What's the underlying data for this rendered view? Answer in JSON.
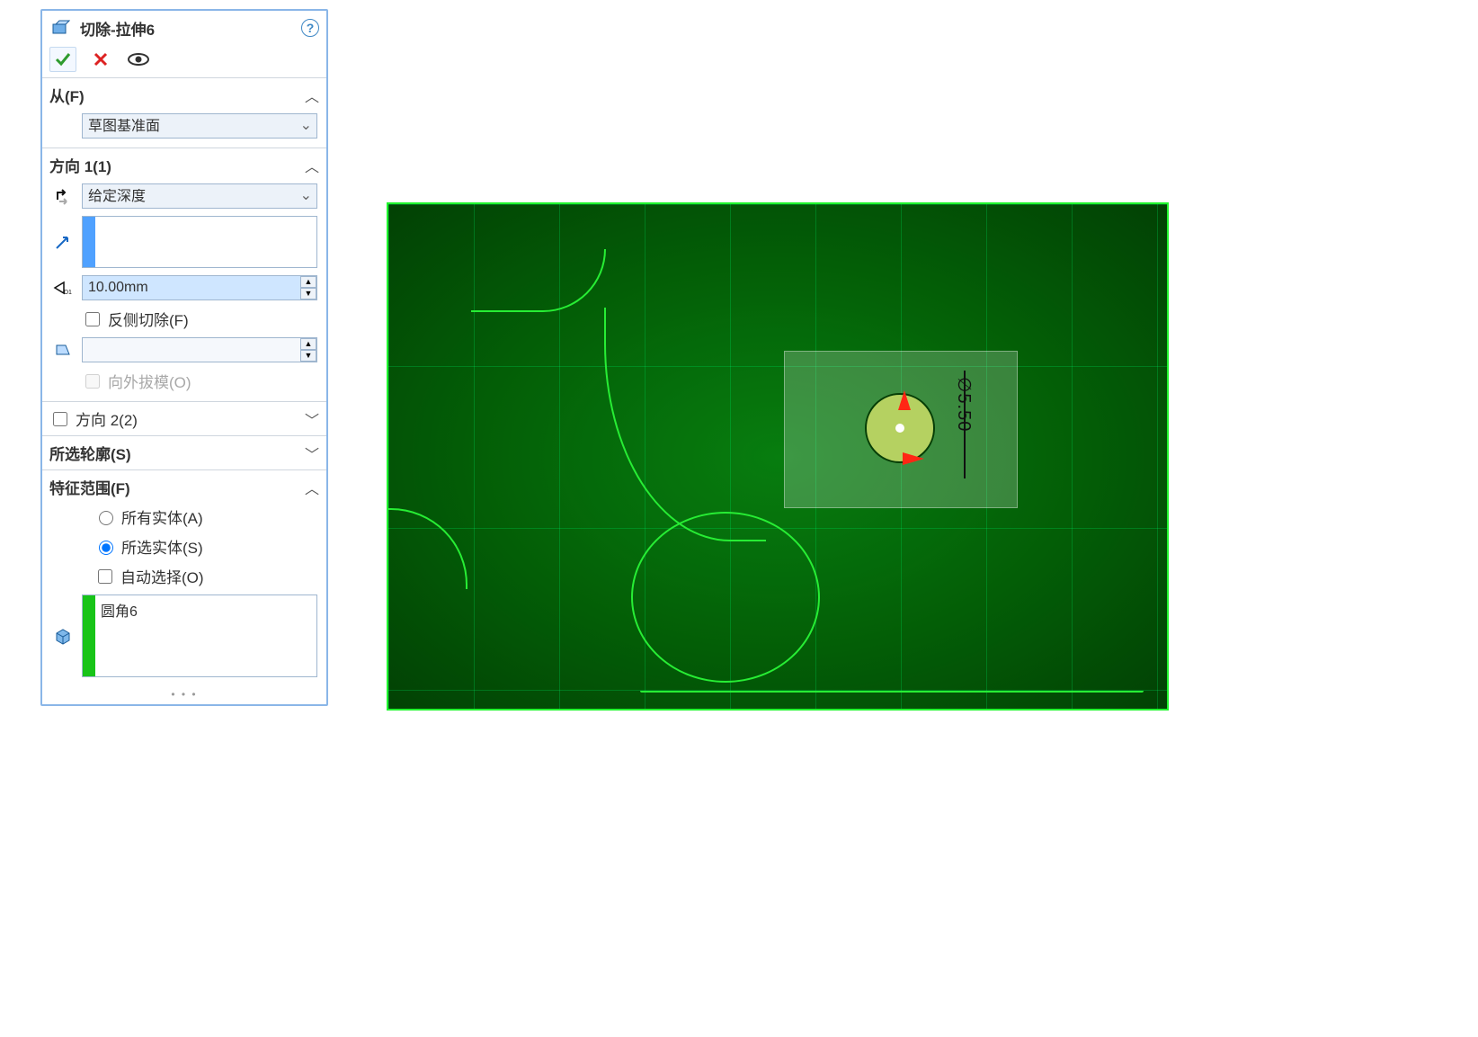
{
  "feature": {
    "title": "切除-拉伸6"
  },
  "sections": {
    "from": {
      "label": "从(F)",
      "start_condition": "草图基准面",
      "expanded": true
    },
    "dir1": {
      "label": "方向 1(1)",
      "end_condition": "给定深度",
      "depth": "10.00mm",
      "flip_side": {
        "label": "反侧切除(F)",
        "checked": false
      },
      "draft_on": {
        "label": "向外拔模(O)",
        "checked": false,
        "disabled": true
      },
      "expanded": true
    },
    "dir2": {
      "label": "方向 2(2)",
      "enabled": false,
      "expanded": false
    },
    "contours": {
      "label": "所选轮廓(S)",
      "expanded": false
    },
    "scope": {
      "label": "特征范围(F)",
      "all_bodies": {
        "label": "所有实体(A)",
        "selected": false
      },
      "sel_bodies": {
        "label": "所选实体(S)",
        "selected": true
      },
      "auto_select": {
        "label": "自动选择(O)",
        "checked": false
      },
      "bodies": [
        "圆角6"
      ],
      "expanded": true
    }
  },
  "viewport": {
    "dimension_label": "∅5.50"
  }
}
